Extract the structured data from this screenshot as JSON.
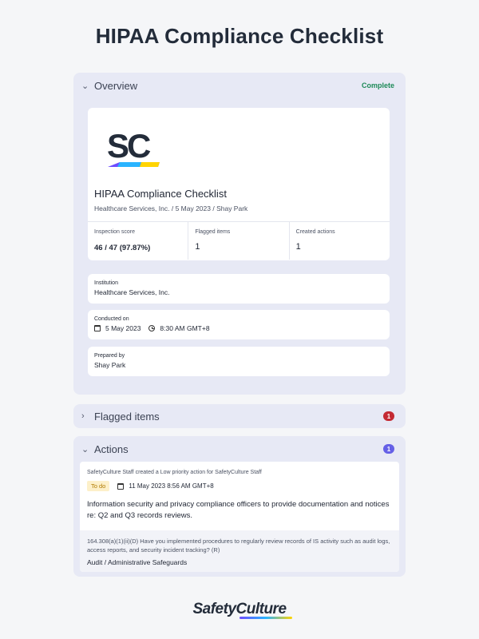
{
  "page": {
    "title": "HIPAA Compliance Checklist"
  },
  "overview": {
    "label": "Overview",
    "status": "Complete",
    "report": {
      "logo_text": "SC",
      "title": "HIPAA Compliance Checklist",
      "subtitle": "Healthcare Services, Inc. / 5 May 2023 / Shay Park"
    },
    "stats": [
      {
        "key": "Inspection score",
        "value": "46 / 47 (97.87%)"
      },
      {
        "key": "Flagged items",
        "value": "1"
      },
      {
        "key": "Created actions",
        "value": "1"
      }
    ],
    "institution": {
      "key": "Institution",
      "value": "Healthcare Services, Inc."
    },
    "conducted": {
      "key": "Conducted on",
      "date": "5 May 2023",
      "time": "8:30 AM GMT+8"
    },
    "prepared": {
      "key": "Prepared by",
      "value": "Shay Park"
    }
  },
  "flagged": {
    "label": "Flagged items",
    "count": "1"
  },
  "actions": {
    "label": "Actions",
    "count": "1",
    "item": {
      "meta": "SafetyCulture Staff created a Low priority action for SafetyCulture Staff",
      "status": "To do",
      "due": "11 May 2023 8:56 AM GMT+8",
      "text": "Information security and privacy compliance officers to provide documentation and notices re: Q2 and Q3 records reviews.",
      "question": "164.308(a)(1)(ii)(D) Have you implemented procedures to regularly review records of IS activity such as audit logs, access reports, and security incident tracking? (R)",
      "path": "Audit / Administrative Safeguards"
    }
  },
  "footer": {
    "brand": "SafetyCulture"
  },
  "colors": {
    "complete": "#1d8a58",
    "flagged_badge": "#c42a33",
    "actions_badge": "#6560e6",
    "todo_bg": "#fdf0c9"
  }
}
